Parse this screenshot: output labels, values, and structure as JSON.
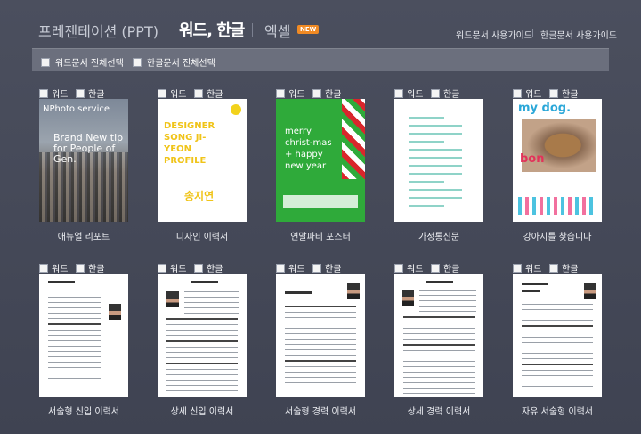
{
  "tabs": [
    {
      "label": "프레젠테이션 (PPT)",
      "active": false
    },
    {
      "label": "워드, 한글",
      "active": true
    },
    {
      "label": "엑셀",
      "active": false,
      "badge": "NEW"
    }
  ],
  "guides": {
    "word": "워드문서 사용가이드",
    "hangul": "한글문서 사용가이드"
  },
  "select_all": {
    "word": "워드문서 전체선택",
    "hangul": "한글문서 전체선택"
  },
  "checkbox_labels": {
    "word": "워드",
    "hangul": "한글"
  },
  "templates": [
    {
      "caption": "애뉴얼 리포트",
      "thumb_text": [
        "NPhoto service",
        "Brand New tip for People of Gen."
      ]
    },
    {
      "caption": "디자인 이력서",
      "thumb_text": [
        "DESIGNER SONG JI-YEON PROFILE",
        "송지연"
      ]
    },
    {
      "caption": "연말파티 포스터",
      "thumb_text": [
        "merry christ-mas + happy new year"
      ]
    },
    {
      "caption": "가정통신문",
      "thumb_text": []
    },
    {
      "caption": "강아지를 찾습니다",
      "thumb_text": [
        "my dog.",
        "bon"
      ]
    },
    {
      "caption": "서술형 신입 이력서",
      "thumb_text": []
    },
    {
      "caption": "상세 신입 이력서",
      "thumb_text": []
    },
    {
      "caption": "서술형 경력 이력서",
      "thumb_text": []
    },
    {
      "caption": "상세 경력 이력서",
      "thumb_text": []
    },
    {
      "caption": "자유 서술형 이력서",
      "thumb_text": []
    }
  ],
  "colors": {
    "background": "#474b5a",
    "selectbar": "#6b6f7d",
    "badge": "#f08a24"
  }
}
